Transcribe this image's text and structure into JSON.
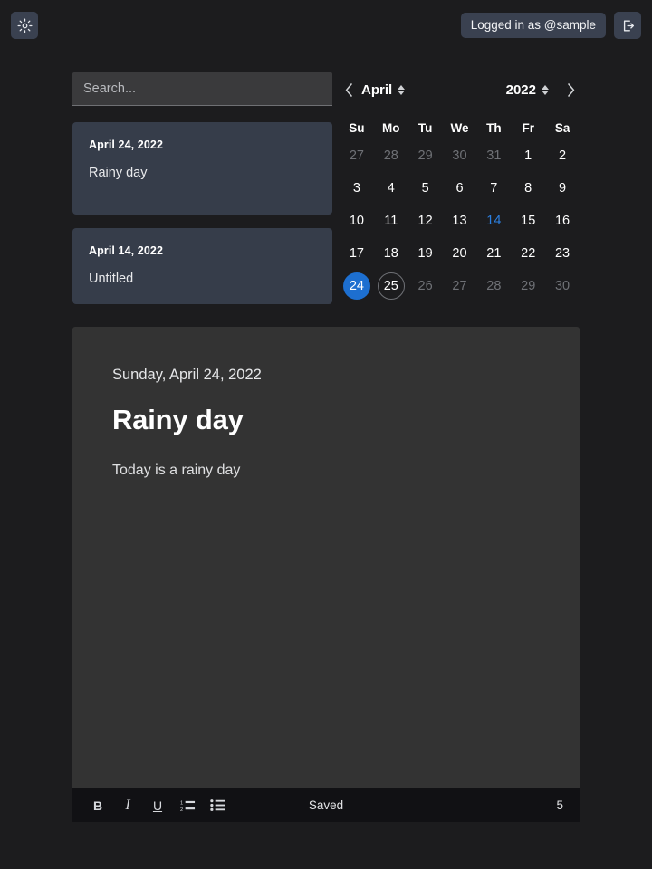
{
  "topbar": {
    "theme_toggle_icon": "sun-brightness-icon",
    "user_badge": "Logged in as @sample",
    "logout_icon": "logout-arrow-icon"
  },
  "search": {
    "value": "",
    "placeholder": "Search..."
  },
  "notes": [
    {
      "date": "April 24, 2022",
      "title": "Rainy day"
    },
    {
      "date": "April 14, 2022",
      "title": "Untitled"
    }
  ],
  "calendar": {
    "prev_label": "chevron-left-icon",
    "next_label": "chevron-right-icon",
    "month": "April",
    "year": "2022",
    "weekdays": [
      "Su",
      "Mo",
      "Tu",
      "We",
      "Th",
      "Fr",
      "Sa"
    ],
    "days": [
      {
        "n": "27",
        "state": "muted"
      },
      {
        "n": "28",
        "state": "muted"
      },
      {
        "n": "29",
        "state": "muted"
      },
      {
        "n": "30",
        "state": "muted"
      },
      {
        "n": "31",
        "state": "muted"
      },
      {
        "n": "1",
        "state": "normal"
      },
      {
        "n": "2",
        "state": "normal"
      },
      {
        "n": "3",
        "state": "normal"
      },
      {
        "n": "4",
        "state": "normal"
      },
      {
        "n": "5",
        "state": "normal"
      },
      {
        "n": "6",
        "state": "normal"
      },
      {
        "n": "7",
        "state": "normal"
      },
      {
        "n": "8",
        "state": "normal"
      },
      {
        "n": "9",
        "state": "normal"
      },
      {
        "n": "10",
        "state": "normal"
      },
      {
        "n": "11",
        "state": "normal"
      },
      {
        "n": "12",
        "state": "normal"
      },
      {
        "n": "13",
        "state": "normal"
      },
      {
        "n": "14",
        "state": "marked"
      },
      {
        "n": "15",
        "state": "normal"
      },
      {
        "n": "16",
        "state": "normal"
      },
      {
        "n": "17",
        "state": "normal"
      },
      {
        "n": "18",
        "state": "normal"
      },
      {
        "n": "19",
        "state": "normal"
      },
      {
        "n": "20",
        "state": "normal"
      },
      {
        "n": "21",
        "state": "normal"
      },
      {
        "n": "22",
        "state": "normal"
      },
      {
        "n": "23",
        "state": "normal"
      },
      {
        "n": "24",
        "state": "selected"
      },
      {
        "n": "25",
        "state": "today"
      },
      {
        "n": "26",
        "state": "muted"
      },
      {
        "n": "27",
        "state": "muted"
      },
      {
        "n": "28",
        "state": "muted"
      },
      {
        "n": "29",
        "state": "muted"
      },
      {
        "n": "30",
        "state": "muted"
      }
    ]
  },
  "editor": {
    "date": "Sunday, April 24, 2022",
    "title": "Rainy day",
    "body": "Today is a rainy day"
  },
  "toolbar": {
    "bold_label": "B",
    "italic_label": "I",
    "underline_label": "U",
    "ordered_list_icon": "numbered-list-icon",
    "bullet_list_icon": "bulleted-list-icon",
    "save_status": "Saved",
    "word_count": "5"
  },
  "colors": {
    "page_bg": "#1c1c1e",
    "card_bg": "#363d4a",
    "editor_bg": "#333333",
    "toolbar_bg": "#111114",
    "accent_blue": "#1d6fd0",
    "marked_blue": "#2b7fe0",
    "muted_text": "#6f7176"
  }
}
